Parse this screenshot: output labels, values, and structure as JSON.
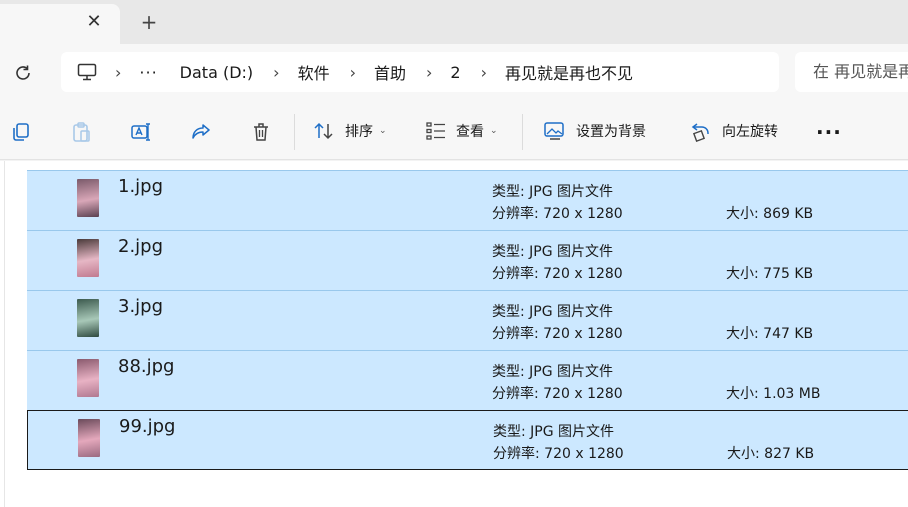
{
  "tabs": {
    "close_glyph": "✕",
    "new_glyph": "+"
  },
  "breadcrumb": {
    "more": "···",
    "separator": "›",
    "items": [
      "Data (D:)",
      "软件",
      "首助",
      "2",
      "再见就是再也不见"
    ]
  },
  "search": {
    "placeholder": "在 再见就是再也不见 中搜索"
  },
  "toolbar": {
    "sort_label": "排序",
    "view_label": "查看",
    "set_background_label": "设置为背景",
    "rotate_left_label": "向左旋转",
    "more_label": "···",
    "caret": "⌄"
  },
  "files": [
    {
      "name": "1.jpg",
      "type": "类型: JPG 图片文件",
      "resolution": "分辨率: 720 x 1280",
      "size": "大小: 869 KB",
      "thumb_colors": [
        "#7a5a6a",
        "#d9a7b8",
        "#5a4050"
      ]
    },
    {
      "name": "2.jpg",
      "type": "类型: JPG 图片文件",
      "resolution": "分辨率: 720 x 1280",
      "size": "大小: 775 KB",
      "thumb_colors": [
        "#4a3a3a",
        "#e6b7c5",
        "#c07a90"
      ]
    },
    {
      "name": "3.jpg",
      "type": "类型: JPG 图片文件",
      "resolution": "分辨率: 720 x 1280",
      "size": "大小: 747 KB",
      "thumb_colors": [
        "#3c5a4e",
        "#a8c8b8",
        "#2f4a40"
      ]
    },
    {
      "name": "88.jpg",
      "type": "类型: JPG 图片文件",
      "resolution": "分辨率: 720 x 1280",
      "size": "大小: 1.03 MB",
      "thumb_colors": [
        "#8a5a6e",
        "#e8b2c4",
        "#b07890"
      ]
    },
    {
      "name": "99.jpg",
      "type": "类型: JPG 图片文件",
      "resolution": "分辨率: 720 x 1280",
      "size": "大小: 827 KB",
      "thumb_colors": [
        "#6a4a5a",
        "#e4a8bc",
        "#9a6a80"
      ]
    }
  ]
}
